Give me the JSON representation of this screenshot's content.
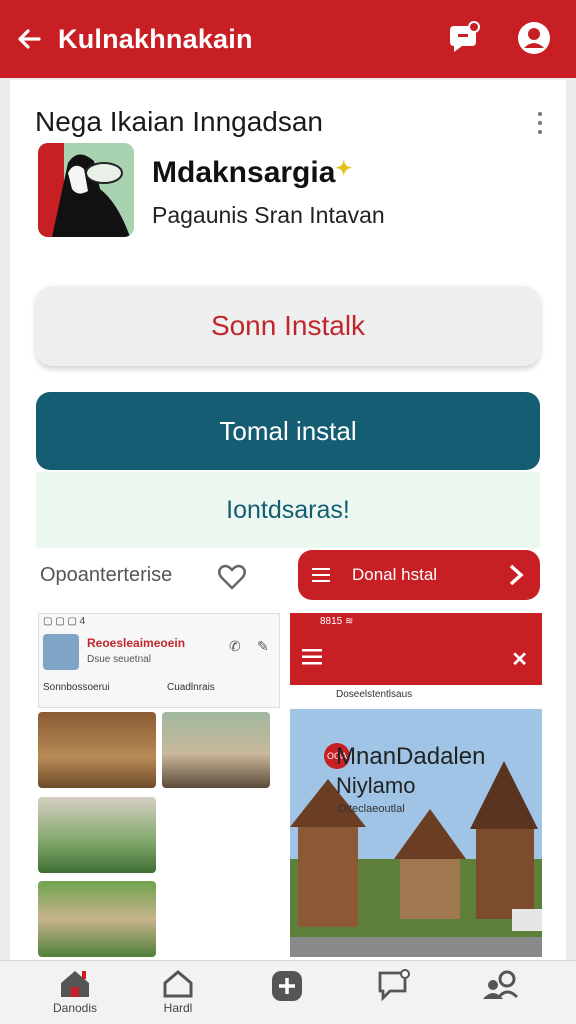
{
  "topbar": {
    "title": "Kulnakhnakain",
    "back_icon": "arrow-left-icon",
    "actions": [
      "notification-icon",
      "profile-icon"
    ]
  },
  "app": {
    "section_title": "Nega Ikaian Inngadsan",
    "name": "Mdaknsargia",
    "subtitle": "Pagaunis Sran  Intavan"
  },
  "buttons": {
    "soon_install": "Sonn Instalk",
    "install": "Tomal instal",
    "banner": "Iontdsaras!",
    "small_install": "Donal hstal"
  },
  "row": {
    "label": "Opoanterterise"
  },
  "screenshot_left": {
    "status": "▢ ▢ ▢ 4",
    "title": "Reoesleaimeoein",
    "subtitle": "Dsue seuetnal",
    "chip1": "Sonnbossoerui",
    "chip2": "Cuadlnrais"
  },
  "screenshot_right": {
    "status": "8815 ≋",
    "strip": "Doseelstentlsaus",
    "badge": "OOA",
    "headline1": "MnanDadalen",
    "headline2": "Niylamo",
    "caption": "Oiteclaeoutlal"
  },
  "bottom_nav": [
    {
      "icon": "home-icon",
      "label": "Danodis"
    },
    {
      "icon": "house-outline-icon",
      "label": "Hardl"
    },
    {
      "icon": "plus-icon",
      "label": ""
    },
    {
      "icon": "chat-icon",
      "label": ""
    },
    {
      "icon": "people-icon",
      "label": ""
    }
  ],
  "colors": {
    "primary_red": "#c81f25",
    "teal": "#145d73",
    "banner_bg": "#ecf8ef"
  }
}
